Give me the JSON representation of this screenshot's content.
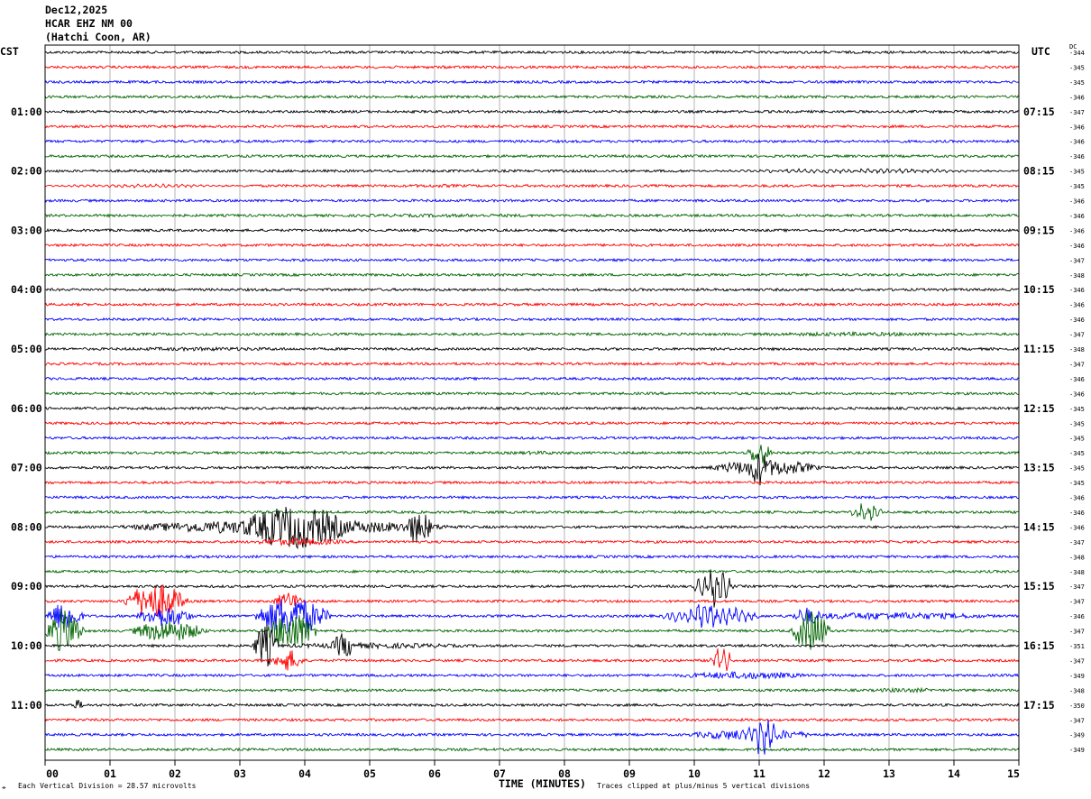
{
  "header": {
    "date": "Dec12,2025",
    "station": "HCAR EHZ NM 00",
    "location": "(Hatchi Coon, AR)"
  },
  "left_label": "CST",
  "right_label": "UTC",
  "dc_label": "DC",
  "footer": {
    "scale_note": "Each Vertical Division =   28.57 microvolts",
    "clip_note": "Traces clipped at plus/minus 5 vertical divisions",
    "corner_mark": "⌖"
  },
  "colors": {
    "black": "#000000",
    "red": "#ff0000",
    "blue": "#0000ff",
    "green": "#006400",
    "grid": "#808080"
  },
  "chart_data": {
    "type": "helicorder",
    "xlabel": "TIME (MINUTES)",
    "x_ticks": [
      "00",
      "01",
      "02",
      "03",
      "04",
      "05",
      "06",
      "07",
      "08",
      "09",
      "10",
      "11",
      "12",
      "13",
      "14",
      "15"
    ],
    "xlim": [
      0,
      15
    ],
    "trace_colors": [
      "black",
      "red",
      "blue",
      "green"
    ],
    "minutes_per_line": 15,
    "num_lines": 48,
    "cst_labels": [
      "01:00",
      "02:00",
      "03:00",
      "04:00",
      "05:00",
      "06:00",
      "07:00",
      "08:00",
      "09:00",
      "10:00",
      "11:00"
    ],
    "utc_labels": [
      "07:15",
      "08:15",
      "09:15",
      "10:15",
      "11:15",
      "12:15",
      "13:15",
      "14:15",
      "15:15",
      "16:15",
      "17:15"
    ],
    "hour_label_every_lines": 4,
    "first_hour_label_line": 4,
    "dc_offsets": [
      "-344",
      "-345",
      "-345",
      "-346",
      "-347",
      "-346",
      "-346",
      "-346",
      "-345",
      "-345",
      "-346",
      "-346",
      "-346",
      "-346",
      "-347",
      "-348",
      "-346",
      "-346",
      "-346",
      "-347",
      "-348",
      "-347",
      "-346",
      "-346",
      "-345",
      "-345",
      "-345",
      "-345",
      "-345",
      "-345",
      "-346",
      "-346",
      "-346",
      "-347",
      "-348",
      "-348",
      "-347",
      "-347",
      "-346",
      "-347",
      "-351",
      "-347",
      "-349",
      "-348",
      "-350",
      "-347",
      "-349",
      "-349"
    ],
    "events": [
      {
        "line": 1,
        "start": 5.0,
        "end": 7.5,
        "amp": 1.6,
        "freq": "high"
      },
      {
        "line": 8,
        "start": 10.0,
        "end": 15.0,
        "amp": 2.6,
        "freq": "low"
      },
      {
        "line": 9,
        "start": 0.0,
        "end": 3.0,
        "amp": 2.2,
        "freq": "low"
      },
      {
        "line": 9,
        "start": 5.0,
        "end": 7.0,
        "amp": 1.8,
        "freq": "high"
      },
      {
        "line": 11,
        "start": 3.0,
        "end": 9.5,
        "amp": 1.8,
        "freq": "high"
      },
      {
        "line": 12,
        "start": 0.0,
        "end": 1.5,
        "amp": 1.4,
        "freq": "high"
      },
      {
        "line": 19,
        "start": 10.0,
        "end": 15.0,
        "amp": 2.2,
        "freq": "high"
      },
      {
        "line": 20,
        "start": 0.0,
        "end": 5.0,
        "amp": 2.0,
        "freq": "high"
      },
      {
        "line": 27,
        "start": 6.8,
        "end": 8.5,
        "amp": 2.0,
        "freq": "high"
      },
      {
        "line": 27,
        "start": 10.8,
        "end": 11.2,
        "amp": 13,
        "freq": "high"
      },
      {
        "line": 28,
        "start": 10.2,
        "end": 12.0,
        "amp": 9,
        "freq": "high"
      },
      {
        "line": 28,
        "start": 10.8,
        "end": 11.2,
        "amp": 20,
        "freq": "high"
      },
      {
        "line": 31,
        "start": 12.4,
        "end": 12.9,
        "amp": 12,
        "freq": "low"
      },
      {
        "line": 32,
        "start": 1.0,
        "end": 6.5,
        "amp": 8,
        "freq": "high"
      },
      {
        "line": 32,
        "start": 2.9,
        "end": 4.8,
        "amp": 24,
        "freq": "high"
      },
      {
        "line": 32,
        "start": 5.5,
        "end": 6.0,
        "amp": 18,
        "freq": "high"
      },
      {
        "line": 33,
        "start": 3.0,
        "end": 4.8,
        "amp": 4,
        "freq": "high"
      },
      {
        "line": 36,
        "start": 10.0,
        "end": 10.6,
        "amp": 22,
        "freq": "low"
      },
      {
        "line": 37,
        "start": 1.2,
        "end": 2.2,
        "amp": 20,
        "freq": "high"
      },
      {
        "line": 37,
        "start": 3.5,
        "end": 4.0,
        "amp": 10,
        "freq": "high"
      },
      {
        "line": 38,
        "start": 0.0,
        "end": 0.6,
        "amp": 16,
        "freq": "high"
      },
      {
        "line": 38,
        "start": 1.4,
        "end": 2.3,
        "amp": 12,
        "freq": "high"
      },
      {
        "line": 38,
        "start": 3.2,
        "end": 4.4,
        "amp": 22,
        "freq": "high"
      },
      {
        "line": 38,
        "start": 9.5,
        "end": 11.0,
        "amp": 14,
        "freq": "low"
      },
      {
        "line": 38,
        "start": 11.5,
        "end": 12.0,
        "amp": 10,
        "freq": "high"
      },
      {
        "line": 38,
        "start": 11.0,
        "end": 15.0,
        "amp": 4,
        "freq": "high"
      },
      {
        "line": 39,
        "start": 0.0,
        "end": 0.6,
        "amp": 24,
        "freq": "high"
      },
      {
        "line": 39,
        "start": 1.3,
        "end": 2.5,
        "amp": 12,
        "freq": "high"
      },
      {
        "line": 39,
        "start": 3.4,
        "end": 4.2,
        "amp": 22,
        "freq": "high"
      },
      {
        "line": 39,
        "start": 11.5,
        "end": 12.1,
        "amp": 24,
        "freq": "high"
      },
      {
        "line": 40,
        "start": 3.2,
        "end": 3.6,
        "amp": 24,
        "freq": "high"
      },
      {
        "line": 40,
        "start": 4.4,
        "end": 4.8,
        "amp": 14,
        "freq": "high"
      },
      {
        "line": 40,
        "start": 3.0,
        "end": 7.0,
        "amp": 3,
        "freq": "high"
      },
      {
        "line": 41,
        "start": 10.2,
        "end": 10.6,
        "amp": 16,
        "freq": "low"
      },
      {
        "line": 41,
        "start": 3.5,
        "end": 4.0,
        "amp": 12,
        "freq": "high"
      },
      {
        "line": 42,
        "start": 9.5,
        "end": 12.0,
        "amp": 4,
        "freq": "high"
      },
      {
        "line": 43,
        "start": 12.5,
        "end": 14.0,
        "amp": 2.5,
        "freq": "high"
      },
      {
        "line": 44,
        "start": 0.4,
        "end": 0.6,
        "amp": 6,
        "freq": "high"
      },
      {
        "line": 46,
        "start": 10.8,
        "end": 11.3,
        "amp": 24,
        "freq": "low"
      },
      {
        "line": 46,
        "start": 9.8,
        "end": 12.0,
        "amp": 6,
        "freq": "high"
      }
    ]
  }
}
